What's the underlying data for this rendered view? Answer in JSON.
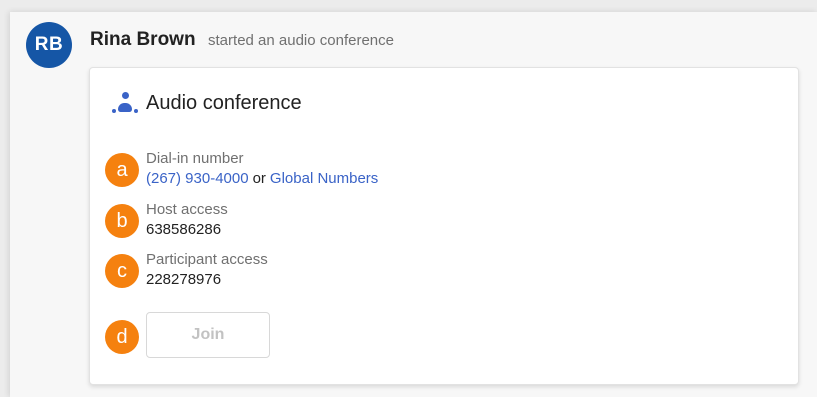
{
  "message": {
    "avatar_initials": "RB",
    "author": "Rina Brown",
    "action": "started an audio conference"
  },
  "card": {
    "icon": "audio-conference-icon",
    "title": "Audio conference",
    "dial_in": {
      "label": "Dial-in number",
      "phone": "(267) 930-4000",
      "or_text": "or",
      "global_link": "Global Numbers"
    },
    "host_access": {
      "label": "Host access",
      "value": "638586286"
    },
    "participant_access": {
      "label": "Participant access",
      "value": "228278976"
    },
    "join_label": "Join"
  },
  "callouts": [
    "a",
    "b",
    "c",
    "d"
  ],
  "colors": {
    "avatar": "#1556a6",
    "link": "#3a63c7",
    "callout": "#f5810f"
  }
}
